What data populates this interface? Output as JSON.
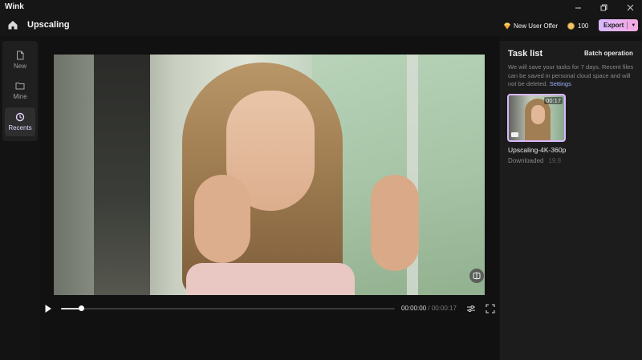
{
  "app": {
    "name": "Wink",
    "page_title": "Upscaling",
    "window_controls": [
      "minimize-icon",
      "restore-icon",
      "close-icon"
    ]
  },
  "header": {
    "new_user_offer": "New User Offer",
    "coins": "100",
    "export_label": "Export"
  },
  "leftnav": {
    "items": [
      {
        "label": "New",
        "icon": "new-file-icon",
        "active": false
      },
      {
        "label": "Mine",
        "icon": "folder-icon",
        "active": false
      },
      {
        "label": "Recents",
        "icon": "history-icon",
        "active": true
      }
    ]
  },
  "player": {
    "current_time": "00:00:00",
    "separator": " / ",
    "total_time": "00:00:17",
    "progress_percent": 6
  },
  "task_panel": {
    "title": "Task list",
    "batch_operation": "Batch operation",
    "notice": "We will save your tasks for 7 days. Recent files can be saved in personal cloud space and will not be deleted.",
    "settings_link": "Settings",
    "tasks": [
      {
        "duration": "00:17",
        "name": "Upscaling-4K-360p",
        "status": "Downloaded",
        "size": "19.8"
      }
    ]
  },
  "colors": {
    "accent": "#d9b6ff",
    "export_gradient_start": "#d9b8ff",
    "export_gradient_end": "#f5a9e0",
    "link": "#9ab6ff"
  }
}
